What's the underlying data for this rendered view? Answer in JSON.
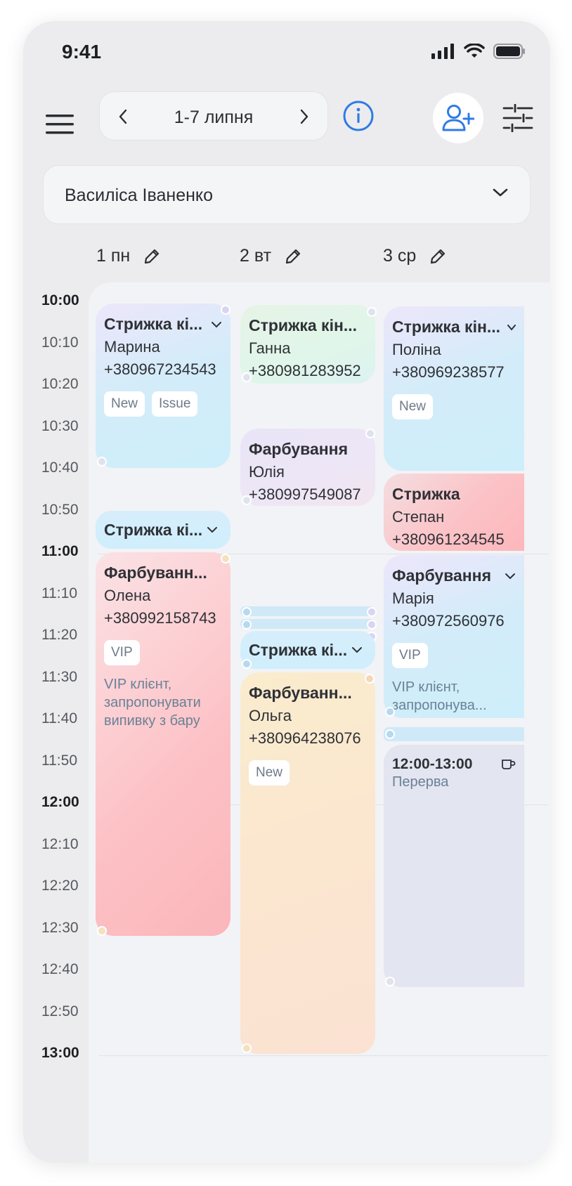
{
  "status_bar": {
    "time": "9:41"
  },
  "header": {
    "week_range": "1-7 липня"
  },
  "employee": {
    "name": "Василіса Іваненко"
  },
  "days": [
    {
      "label": "1 пн"
    },
    {
      "label": "2 вт"
    },
    {
      "label": "3 ср"
    }
  ],
  "times": [
    "10:00",
    "10:10",
    "10:20",
    "10:30",
    "10:40",
    "10:50",
    "11:00",
    "11:10",
    "11:20",
    "11:30",
    "11:40",
    "11:50",
    "12:00",
    "12:10",
    "12:20",
    "12:30",
    "12:40",
    "12:50",
    "13:00"
  ],
  "appointments": {
    "mon_1": {
      "title": "Стрижка кі...",
      "client": "Марина",
      "phone": "+380967234543",
      "tags": [
        "New",
        "Issue"
      ]
    },
    "mon_2": {
      "title": "Стрижка кі..."
    },
    "mon_3": {
      "title": "Фарбуванн...",
      "client": "Олена",
      "phone": "+380992158743",
      "tags": [
        "VIP"
      ],
      "note": "VIP клієнт,\nзапропонувати\nвипивку з бару"
    },
    "tue_1": {
      "title": "Стрижка кін...",
      "client": "Ганна",
      "phone": "+380981283952"
    },
    "tue_2": {
      "title": "Фарбування",
      "client": "Юлія",
      "phone": "+380997549087"
    },
    "tue_3": {
      "title": "Стрижка кі..."
    },
    "tue_4": {
      "title": "Фарбуванн...",
      "client": "Ольга",
      "phone": "+380964238076",
      "tags": [
        "New"
      ]
    },
    "wed_1": {
      "title": "Стрижка кін...",
      "client": "Поліна",
      "phone": "+380969238577",
      "tags": [
        "New"
      ]
    },
    "wed_2": {
      "title": "Стрижка",
      "client": "Степан",
      "phone": "+380961234545"
    },
    "wed_3": {
      "title": "Фарбування",
      "client": "Марія",
      "phone": "+380972560976",
      "tags": [
        "VIP"
      ],
      "note": "VIP клієнт,\nзапропонува..."
    },
    "wed_break": {
      "time": "12:00-13:00",
      "label": "Перерва"
    }
  },
  "colors": {
    "accent": "#2f7be5",
    "background": "#ececee"
  },
  "icons": {
    "menu": "hamburger-icon",
    "prev": "chevron-left-icon",
    "next": "chevron-right-icon",
    "info": "info-icon",
    "add_client": "add-user-icon",
    "filter": "sliders-icon",
    "edit": "pencil-icon",
    "break": "cup-icon"
  }
}
